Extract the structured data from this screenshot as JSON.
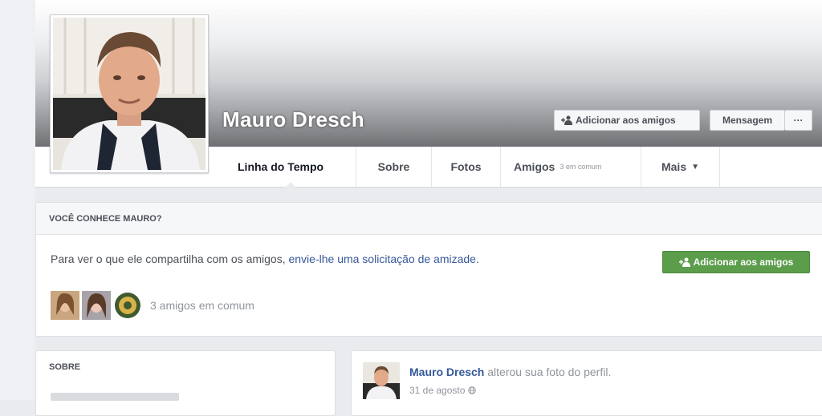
{
  "profile": {
    "name": "Mauro Dresch",
    "add_friend_label": "Adicionar aos amigos",
    "message_label": "Mensagem",
    "more_label": "···"
  },
  "tabs": [
    {
      "label": "Linha do Tempo"
    },
    {
      "label": "Sobre"
    },
    {
      "label": "Fotos"
    },
    {
      "label": "Amigos",
      "sub": "3 em comum"
    },
    {
      "label": "Mais"
    }
  ],
  "know_card": {
    "heading": "VOCÊ CONHECE MAURO?",
    "text_prefix": "Para ver o que ele compartilha com os amigos, ",
    "text_link": "envie-lhe uma solicitação de amizade",
    "text_suffix": ".",
    "add_friend_label": "Adicionar aos amigos",
    "mutual_friends": "3 amigos em comum"
  },
  "sobre_card": {
    "heading": "SOBRE"
  },
  "post": {
    "author": "Mauro Dresch",
    "action": " alterou sua foto do perfil.",
    "date": "31 de agosto"
  },
  "colors": {
    "link": "#365899",
    "green_button": "#5b9d4b",
    "background": "#e9ebee"
  },
  "icons": [
    "add-friend-icon",
    "chevron-down-icon",
    "globe-icon"
  ]
}
